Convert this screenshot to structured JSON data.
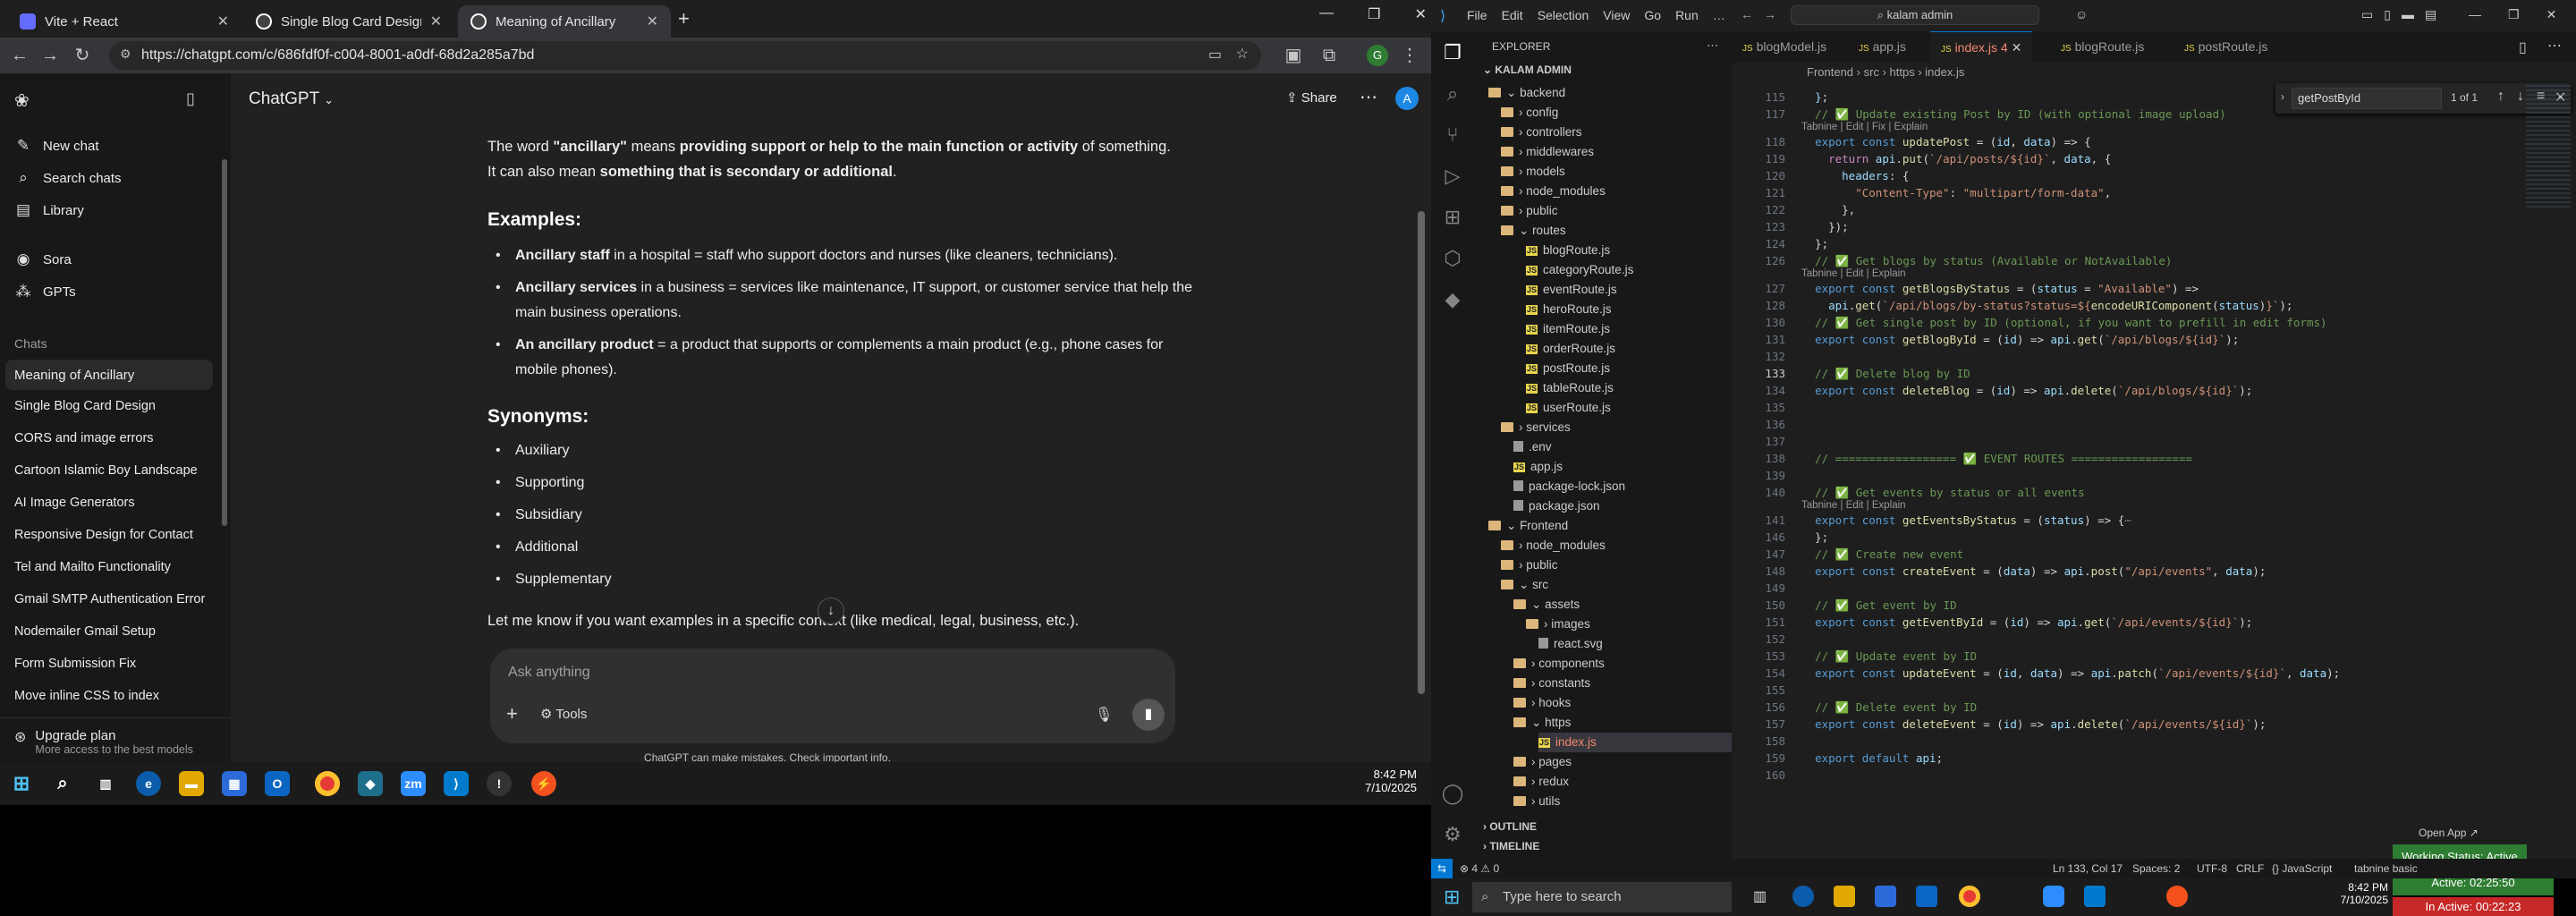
{
  "browser": {
    "tabs": [
      {
        "title": "Vite + React",
        "favicon_color": "#646cff"
      },
      {
        "title": "Single Blog Card Design",
        "favicon_color": "#555555"
      },
      {
        "title": "Meaning of Ancillary",
        "favicon_color": "#555555"
      }
    ],
    "url": "https://chatgpt.com/c/686fdf0f-c004-8001-a0df-68d2a285a7bd",
    "window_buttons": [
      "—",
      "❐",
      "✕"
    ]
  },
  "chatgpt": {
    "model": "ChatGPT",
    "share_label": "Share",
    "avatar_letter": "A",
    "sidebar": {
      "items": [
        {
          "label": "New chat",
          "icon": "edit-icon"
        },
        {
          "label": "Search chats",
          "icon": "search-icon"
        },
        {
          "label": "Library",
          "icon": "library-icon"
        },
        {
          "label": "Sora",
          "icon": "sora-icon"
        },
        {
          "label": "GPTs",
          "icon": "gpts-icon"
        }
      ],
      "chats_heading": "Chats",
      "chats": [
        "Meaning of Ancillary",
        "Single Blog Card Design",
        "CORS and image errors",
        "Cartoon Islamic Boy Landscape",
        "AI Image Generators",
        "Responsive Design for Contact",
        "Tel and Mailto Functionality",
        "Gmail SMTP Authentication Error",
        "Nodemailer Gmail Setup",
        "Form Submission Fix",
        "Move inline CSS to index"
      ],
      "upgrade_title": "Upgrade plan",
      "upgrade_sub": "More access to the best models"
    },
    "message": {
      "intro_1": "The word ",
      "intro_word": "\"ancillary\"",
      "intro_2": " means ",
      "intro_bold": "providing support or help to the main function or activity",
      "intro_3": " of something. It can also mean ",
      "intro_bold2": "something that is secondary or additional",
      "intro_4": ".",
      "examples_heading": "Examples:",
      "examples": [
        {
          "bold": "Ancillary staff",
          "rest": " in a hospital = staff who support doctors and nurses (like cleaners, technicians)."
        },
        {
          "bold": "Ancillary services",
          "rest": " in a business = services like maintenance, IT support, or customer service that help the main business operations."
        },
        {
          "bold": "An ancillary product",
          "rest": " = a product that supports or complements a main product (e.g., phone cases for mobile phones)."
        }
      ],
      "synonyms_heading": "Synonyms:",
      "synonyms": [
        "Auxiliary",
        "Supporting",
        "Subsidiary",
        "Additional",
        "Supplementary"
      ],
      "closing": "Let me know if you want examples in a specific context (like medical, legal, business, etc.)."
    },
    "composer": {
      "placeholder": "Ask anything",
      "plus": "+",
      "tools": "Tools"
    },
    "disclaimer": "ChatGPT can make mistakes. Check important info."
  },
  "taskbar_left": {
    "time": "8:42 PM",
    "date": "7/10/2025"
  },
  "vscode": {
    "menu": [
      "File",
      "Edit",
      "Selection",
      "View",
      "Go",
      "Run",
      "…"
    ],
    "search": "kalam admin",
    "explorer_title": "EXPLORER",
    "root": "KALAM ADMIN",
    "tree": [
      {
        "label": "backend",
        "kind": "folder",
        "depth": 0
      },
      {
        "label": "config",
        "kind": "folder",
        "depth": 1
      },
      {
        "label": "controllers",
        "kind": "folder",
        "depth": 1
      },
      {
        "label": "middlewares",
        "kind": "folder",
        "depth": 1
      },
      {
        "label": "models",
        "kind": "folder",
        "depth": 1
      },
      {
        "label": "node_modules",
        "kind": "folder",
        "depth": 1
      },
      {
        "label": "public",
        "kind": "folder",
        "depth": 1
      },
      {
        "label": "routes",
        "kind": "folder",
        "depth": 1
      },
      {
        "label": "blogRoute.js",
        "kind": "js",
        "depth": 2
      },
      {
        "label": "categoryRoute.js",
        "kind": "js",
        "depth": 2
      },
      {
        "label": "eventRoute.js",
        "kind": "js",
        "depth": 2
      },
      {
        "label": "heroRoute.js",
        "kind": "js",
        "depth": 2
      },
      {
        "label": "itemRoute.js",
        "kind": "js",
        "depth": 2
      },
      {
        "label": "orderRoute.js",
        "kind": "js",
        "depth": 2
      },
      {
        "label": "postRoute.js",
        "kind": "js",
        "depth": 2
      },
      {
        "label": "tableRoute.js",
        "kind": "js",
        "depth": 2
      },
      {
        "label": "userRoute.js",
        "kind": "js",
        "depth": 2
      },
      {
        "label": "services",
        "kind": "folder",
        "depth": 1
      },
      {
        "label": ".env",
        "kind": "other",
        "depth": 1
      },
      {
        "label": "app.js",
        "kind": "js",
        "depth": 1
      },
      {
        "label": "package-lock.json",
        "kind": "other",
        "depth": 1
      },
      {
        "label": "package.json",
        "kind": "other",
        "depth": 1
      },
      {
        "label": "Frontend",
        "kind": "folder",
        "depth": 0
      },
      {
        "label": "node_modules",
        "kind": "folder",
        "depth": 1
      },
      {
        "label": "public",
        "kind": "folder",
        "depth": 1
      },
      {
        "label": "src",
        "kind": "folder",
        "depth": 1
      },
      {
        "label": "assets",
        "kind": "folder",
        "depth": 2
      },
      {
        "label": "images",
        "kind": "folder",
        "depth": 3
      },
      {
        "label": "react.svg",
        "kind": "other",
        "depth": 3
      },
      {
        "label": "components",
        "kind": "folder",
        "depth": 2
      },
      {
        "label": "constants",
        "kind": "folder",
        "depth": 2
      },
      {
        "label": "hooks",
        "kind": "folder",
        "depth": 2
      },
      {
        "label": "https",
        "kind": "folder",
        "depth": 2
      },
      {
        "label": "index.js",
        "kind": "js",
        "depth": 3
      },
      {
        "label": "pages",
        "kind": "folder",
        "depth": 2
      },
      {
        "label": "redux",
        "kind": "folder",
        "depth": 2
      },
      {
        "label": "utils",
        "kind": "folder",
        "depth": 2
      }
    ],
    "outline": "OUTLINE",
    "timeline": "TIMELINE",
    "tabs": [
      "blogModel.js",
      "app.js",
      "index.js",
      "blogRoute.js",
      "postRoute.js"
    ],
    "active_tab_badge": "4",
    "breadcrumb": [
      "Frontend",
      "src",
      "https",
      "index.js"
    ],
    "find": {
      "query": "getPostById",
      "result": "1 of 1"
    },
    "status": {
      "errors": "⊗ 4 ⚠ 0",
      "position": "Ln 133, Col 17",
      "spaces": "Spaces: 2",
      "encoding": "UTF-8",
      "eol": "CRLF",
      "language": "{} JavaScript",
      "tabnine": "tabnine basic"
    },
    "open_app": "Open App ↗",
    "working_status": "Working Status: Active",
    "active_time": "Active: 02:25:50",
    "inactive_time": "In Active: 00:22:23",
    "lens": "Tabnine | Edit | Explain",
    "lens_fix": "Tabnine | Edit | Fix | Explain"
  },
  "taskbar_right": {
    "search_placeholder": "Type here to search",
    "time": "8:42 PM",
    "date": "7/10/2025"
  }
}
